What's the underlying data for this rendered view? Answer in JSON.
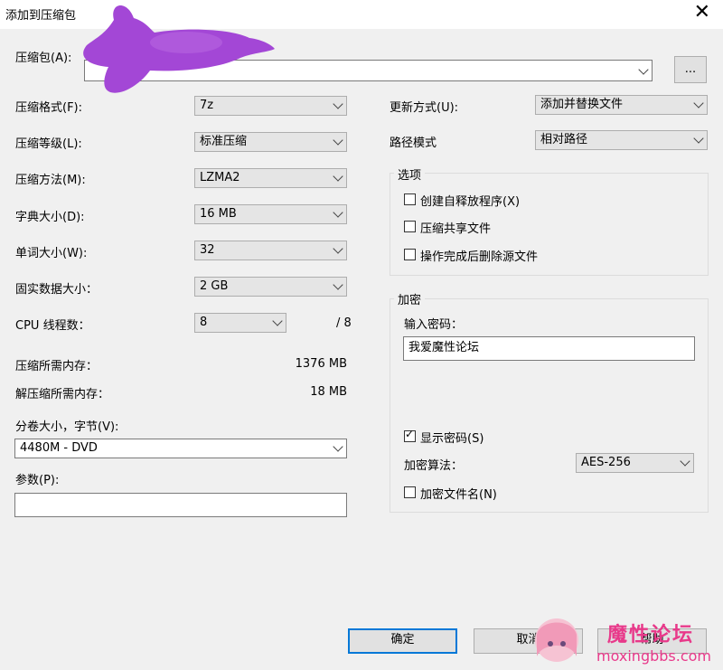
{
  "window": {
    "title": "添加到压缩包",
    "close": "✕"
  },
  "archive": {
    "label": "压缩包(A):",
    "value": "",
    "browse": "..."
  },
  "left": {
    "format": {
      "label": "压缩格式(F):",
      "value": "7z"
    },
    "level": {
      "label": "压缩等级(L):",
      "value": "标准压缩"
    },
    "method": {
      "label": "压缩方法(M):",
      "value": "LZMA2"
    },
    "dict": {
      "label": "字典大小(D):",
      "value": "16 MB"
    },
    "word": {
      "label": "单词大小(W):",
      "value": "32"
    },
    "solid": {
      "label": "固实数据大小：",
      "value": "2 GB"
    },
    "threads": {
      "label": "CPU 线程数：",
      "value": "8",
      "total": "/ 8"
    },
    "mem_compress": {
      "label": "压缩所需内存：",
      "value": "1376 MB"
    },
    "mem_decompress": {
      "label": "解压缩所需内存：",
      "value": "18 MB"
    },
    "volume": {
      "label": "分卷大小，字节(V):",
      "value": "4480M - DVD"
    },
    "params": {
      "label": "参数(P):",
      "value": ""
    }
  },
  "right": {
    "update": {
      "label": "更新方式(U):",
      "value": "添加并替换文件"
    },
    "path": {
      "label": "路径模式",
      "value": "相对路径"
    },
    "options": {
      "title": "选项",
      "sfx": "创建自释放程序(X)",
      "shared": "压缩共享文件",
      "delete": "操作完成后删除源文件"
    },
    "encryption": {
      "title": "加密",
      "password_label": "输入密码：",
      "password": "我爱魔性论坛",
      "show_password": "显示密码(S)",
      "method_label": "加密算法：",
      "method": "AES-256",
      "encrypt_names": "加密文件名(N)"
    }
  },
  "buttons": {
    "ok": "确定",
    "cancel": "取消",
    "help": "帮助"
  },
  "watermark": {
    "text1": "魔性论坛",
    "text2": "moxingbbs.com"
  },
  "colors": {
    "accent": "#0078d7",
    "watermark": "#e8398a",
    "blob": "#a347d6"
  }
}
